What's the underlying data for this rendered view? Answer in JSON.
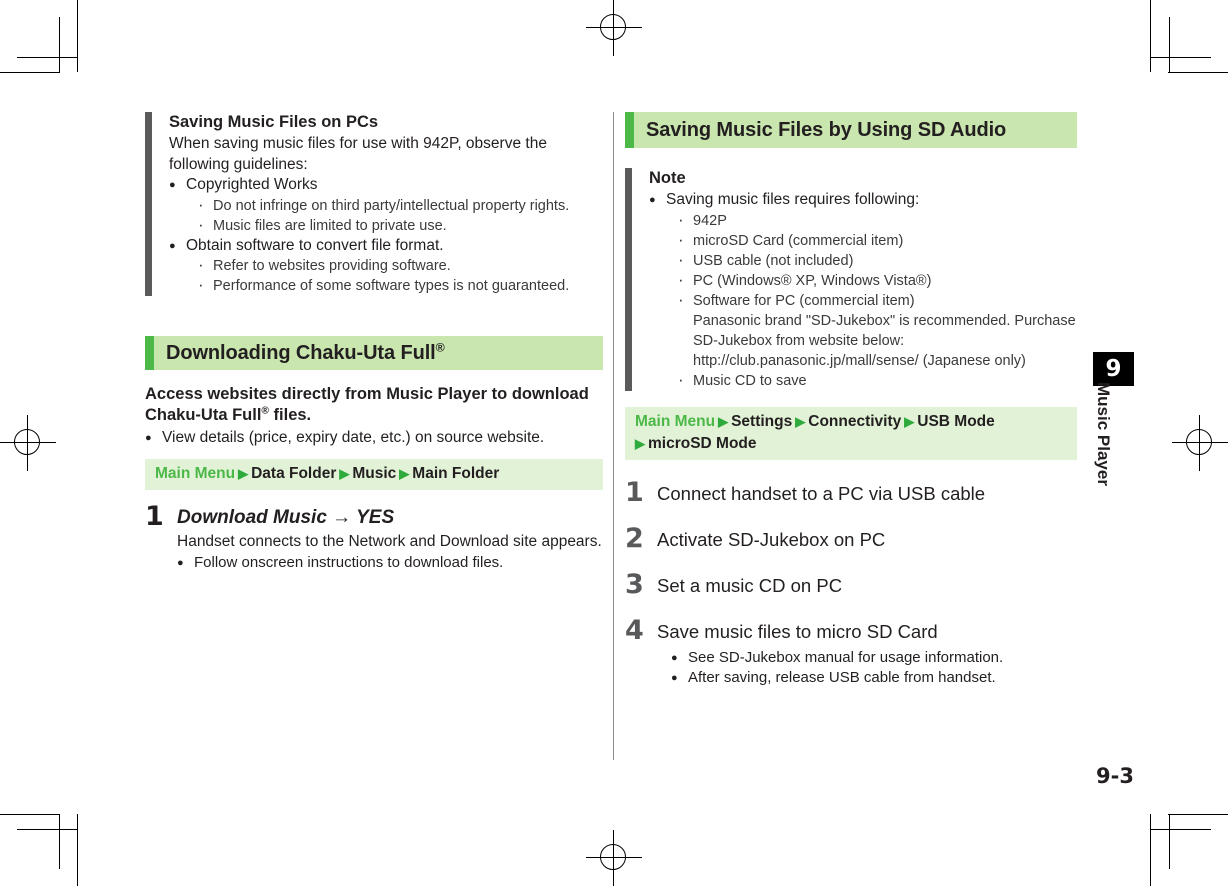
{
  "page": {
    "number": "9-3",
    "chapter_number": "9",
    "chapter_label": "Music Player"
  },
  "left_column": {
    "note_block": {
      "title": "Saving Music Files on PCs",
      "paragraph": "When saving music files for use with 942P, observe the following guidelines:",
      "items": [
        {
          "label": "Copyrighted Works",
          "sub": [
            "Do not infringe on third party/intellectual property rights.",
            "Music files are limited to private use."
          ]
        },
        {
          "label": "Obtain software to convert file format.",
          "sub": [
            "Refer to websites providing software.",
            "Performance of some software types is not guaranteed."
          ]
        }
      ]
    },
    "section": {
      "heading": "Downloading Chaku-Uta Full",
      "heading_sup": "®",
      "lead_line1": "Access websites directly from Music Player to download",
      "lead_line2_a": "Chaku-Uta Full",
      "lead_line2_sup": "®",
      "lead_line2_b": " files.",
      "lead_bullet": "View details (price, expiry date, etc.) on source website.",
      "menu_path": {
        "root": "Main Menu",
        "items": [
          "Data Folder",
          "Music",
          "Main Folder"
        ],
        "arrow": "▶"
      },
      "steps": [
        {
          "number": "1",
          "title": "Download Music → YES",
          "detail": "Handset connects to the Network and Download site appears.",
          "bullets": [
            "Follow onscreen instructions to download files."
          ]
        }
      ]
    }
  },
  "right_column": {
    "section_heading": "Saving Music Files by Using SD Audio",
    "note_block": {
      "title": "Note",
      "items": [
        {
          "label": "Saving music files requires following:",
          "sub": [
            {
              "text": "942P",
              "cont": []
            },
            {
              "text": "microSD Card (commercial item)",
              "cont": []
            },
            {
              "text": "USB cable (not included)",
              "cont": []
            },
            {
              "text": "PC (Windows® XP, Windows Vista®)",
              "cont": []
            },
            {
              "text": "Software for PC (commercial item)",
              "cont": [
                "Panasonic brand \"SD-Jukebox\" is recommended. Purchase",
                "SD-Jukebox from website below:",
                "http://club.panasonic.jp/mall/sense/ (Japanese only)"
              ]
            },
            {
              "text": "Music CD to save",
              "cont": []
            }
          ]
        }
      ]
    },
    "menu_path": {
      "root": "Main Menu",
      "items": [
        "Settings",
        "Connectivity",
        "USB Mode",
        "microSD Mode"
      ],
      "arrow": "▶"
    },
    "steps": [
      {
        "number": "1",
        "title": "Connect handset to a PC via USB cable",
        "bullets": []
      },
      {
        "number": "2",
        "title": "Activate SD-Jukebox on PC",
        "bullets": []
      },
      {
        "number": "3",
        "title": "Set a music CD on PC",
        "bullets": []
      },
      {
        "number": "4",
        "title": "Save music files to micro SD Card",
        "bullets": [
          "See SD-Jukebox manual for usage information.",
          "After saving, release USB cable from handset."
        ]
      }
    ]
  },
  "colors": {
    "accent_green": "#4cb848",
    "heading_bg": "#c8e6ae",
    "path_bg": "#e2f2d7",
    "note_rule": "#5a5a5a",
    "step_num_gray": "#58595b"
  }
}
